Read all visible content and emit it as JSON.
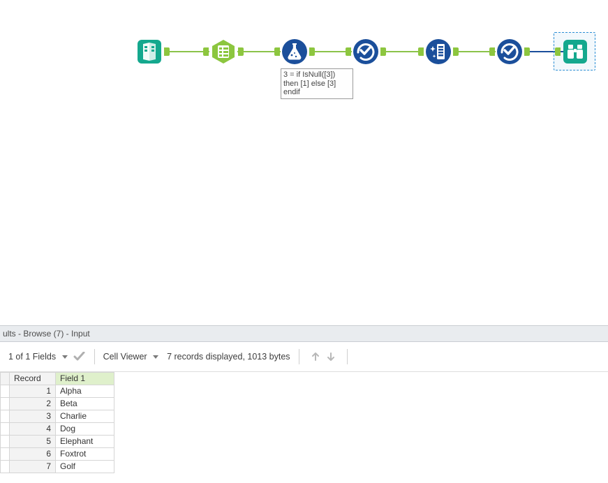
{
  "workflow": {
    "tools": [
      {
        "name": "input-data-tool",
        "icon": "book-input"
      },
      {
        "name": "select-tool",
        "icon": "table"
      },
      {
        "name": "formula-tool",
        "icon": "flask"
      },
      {
        "name": "select-records-tool-1",
        "icon": "check-select"
      },
      {
        "name": "data-cleanse-tool",
        "icon": "sparkle-column"
      },
      {
        "name": "select-records-tool-2",
        "icon": "check-select"
      },
      {
        "name": "browse-tool",
        "icon": "binoculars"
      }
    ],
    "formula_annotation": "3 = if IsNull([3]) then [1] else [3] endif"
  },
  "results": {
    "panel_title": "ults - Browse (7) - Input",
    "fields_label": "1 of 1 Fields",
    "cell_viewer_label": "Cell Viewer",
    "status_text": "7 records displayed, 1013 bytes",
    "columns": {
      "record": "Record",
      "field1": "Field 1"
    },
    "rows": [
      {
        "n": "1",
        "v": "Alpha"
      },
      {
        "n": "2",
        "v": "Beta"
      },
      {
        "n": "3",
        "v": "Charlie"
      },
      {
        "n": "4",
        "v": "Dog"
      },
      {
        "n": "5",
        "v": "Elephant"
      },
      {
        "n": "6",
        "v": "Foxtrot"
      },
      {
        "n": "7",
        "v": "Golf"
      }
    ]
  }
}
